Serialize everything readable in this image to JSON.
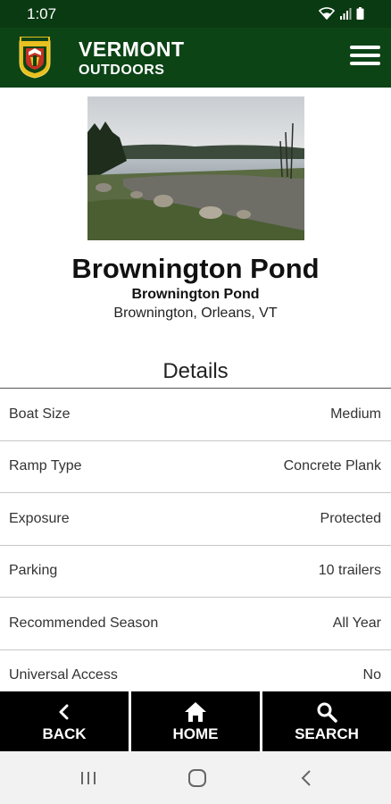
{
  "status_bar": {
    "time": "1:07"
  },
  "header": {
    "brand_title": "VERMONT",
    "brand_subtitle": "OUTDOORS",
    "color": "#0c4416"
  },
  "site": {
    "name": "Brownington Pond",
    "subtitle": "Brownington Pond",
    "location": "Brownington, Orleans, VT"
  },
  "details": {
    "heading": "Details",
    "rows": [
      {
        "label": "Boat Size",
        "value": "Medium"
      },
      {
        "label": "Ramp Type",
        "value": "Concrete Plank"
      },
      {
        "label": "Exposure",
        "value": "Protected"
      },
      {
        "label": "Parking",
        "value": "10 trailers"
      },
      {
        "label": "Recommended Season",
        "value": "All Year"
      },
      {
        "label": "Universal Access",
        "value": "No"
      }
    ]
  },
  "bottom_nav": {
    "back": {
      "label": "BACK",
      "icon": "chevron-left-icon"
    },
    "home": {
      "label": "HOME",
      "icon": "home-icon"
    },
    "search": {
      "label": "SEARCH",
      "icon": "search-icon"
    }
  }
}
